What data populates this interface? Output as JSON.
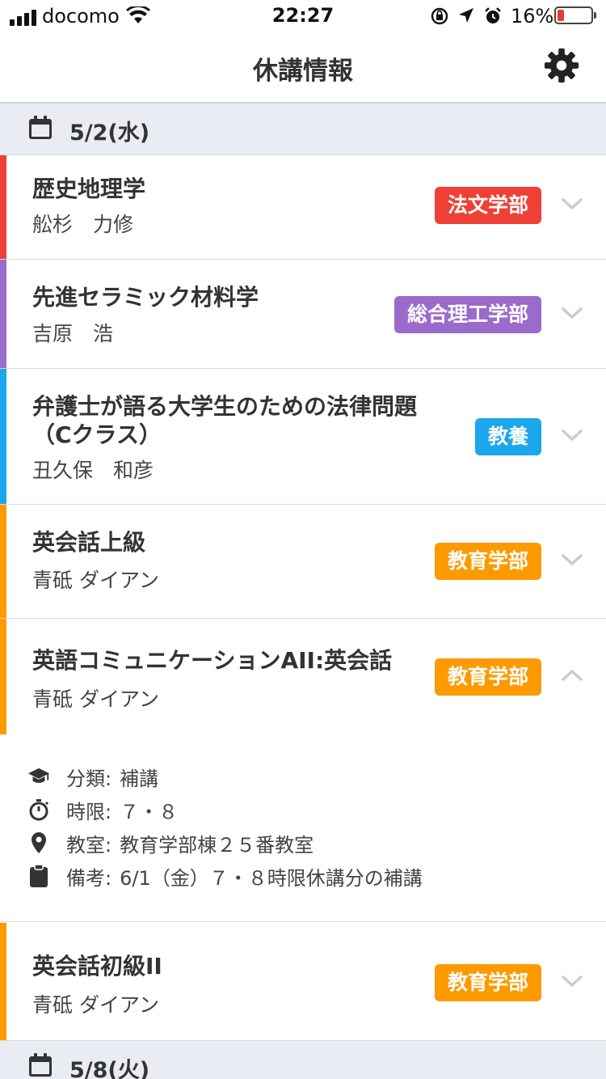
{
  "status_bar": {
    "carrier": "docomo",
    "time": "22:27",
    "battery_percent": "16%",
    "battery_level": 0.16
  },
  "nav": {
    "title": "休講情報",
    "settings_icon": "gear-icon"
  },
  "colors": {
    "law": "#ef4036",
    "science": "#9b6bcb",
    "liberal": "#1aa7ec",
    "education": "#fd9a00"
  },
  "sections": [
    {
      "date": "5/2(水)",
      "courses": [
        {
          "title": "歴史地理学",
          "teacher": "舩杉　力修",
          "faculty": "法文学部",
          "color": "#ef4036"
        },
        {
          "title": "先進セラミック材料学",
          "teacher": "吉原　浩",
          "faculty": "総合理工学部",
          "color": "#9b6bcb"
        },
        {
          "title_line1": "弁護士が語る大学生のための法律問題",
          "title_line2": "（Cクラス）",
          "teacher": "丑久保　和彦",
          "faculty": "教養",
          "color": "#1aa7ec"
        },
        {
          "title": "英会話上級",
          "teacher": "青砥 ダイアン",
          "faculty": "教育学部",
          "color": "#fd9a00"
        },
        {
          "title": "英語コミュニケーションAII:英会話",
          "teacher": "青砥 ダイアン",
          "faculty": "教育学部",
          "color": "#fd9a00",
          "expanded": true,
          "details": {
            "category_label": "分類:",
            "category_value": "補講",
            "period_label": "時限:",
            "period_value": "７・８",
            "room_label": "教室:",
            "room_value": "教育学部棟２５番教室",
            "note_label": "備考:",
            "note_value": "6/1（金）７・８時限休講分の補講"
          }
        },
        {
          "title": "英会話初級II",
          "teacher": "青砥 ダイアン",
          "faculty": "教育学部",
          "color": "#fd9a00"
        }
      ]
    },
    {
      "date": "5/8(火)"
    }
  ]
}
